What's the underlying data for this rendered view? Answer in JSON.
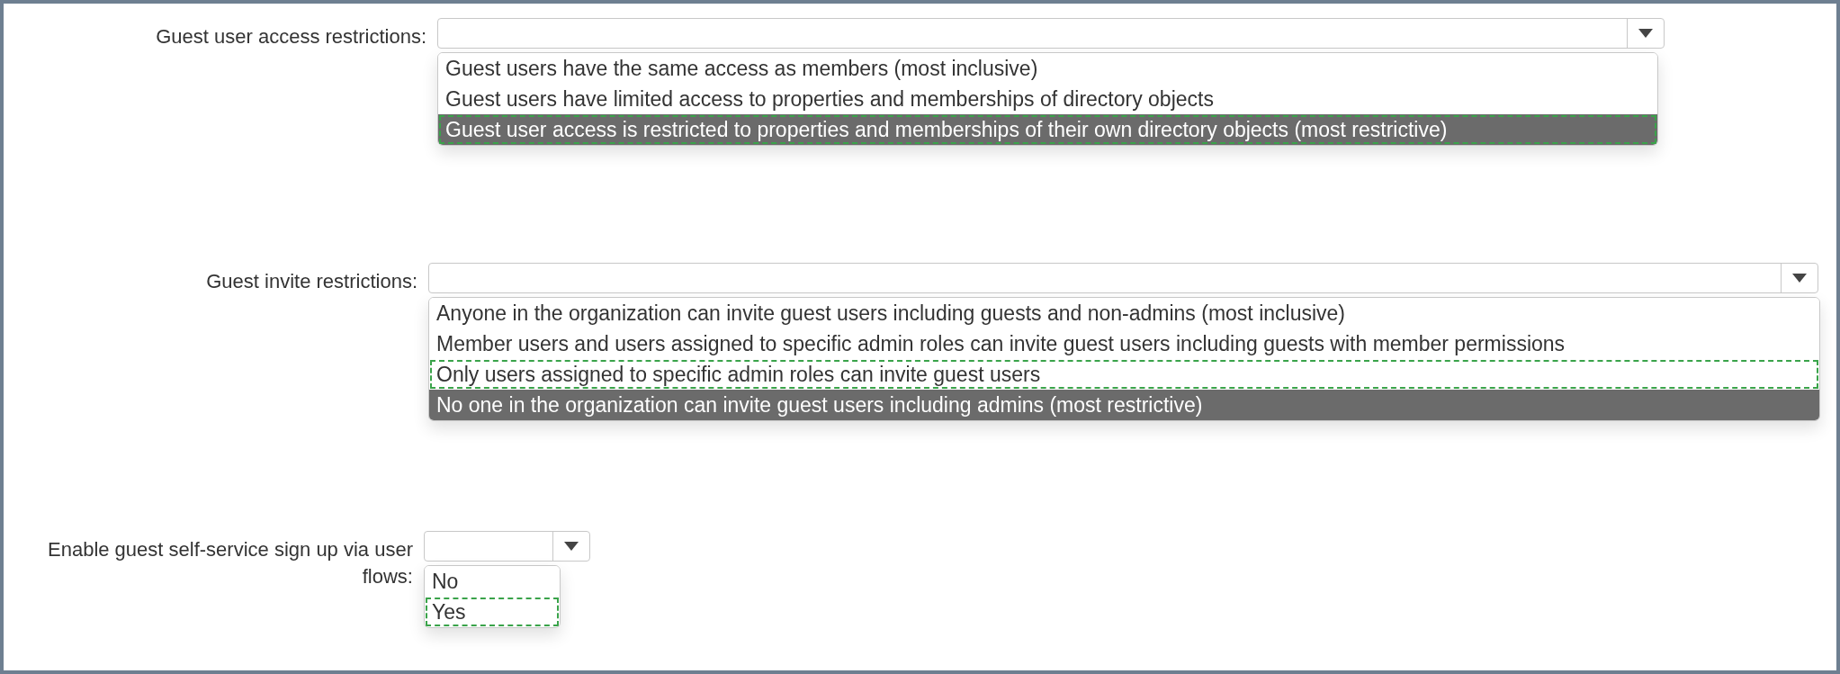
{
  "settings": [
    {
      "label": "Guest user access restrictions:",
      "kind": "wide",
      "options": [
        {
          "text": "Guest users have the same access as members (most inclusive)",
          "selected": false,
          "marked": false
        },
        {
          "text": "Guest users have limited access to properties and memberships of directory objects",
          "selected": false,
          "marked": false
        },
        {
          "text": "Guest user access is restricted to properties and memberships of their own directory objects (most restrictive)",
          "selected": true,
          "marked": true
        }
      ]
    },
    {
      "label": "Guest invite restrictions:",
      "kind": "full",
      "options": [
        {
          "text": "Anyone in the organization can invite guest users including guests and non-admins (most inclusive)",
          "selected": false,
          "marked": false
        },
        {
          "text": "Member users and users assigned to specific admin roles can invite guest users including guests with member permissions",
          "selected": false,
          "marked": false
        },
        {
          "text": "Only users assigned to specific admin roles can invite guest users",
          "selected": false,
          "marked": true
        },
        {
          "text": "No one in the organization can invite guest users including admins (most restrictive)",
          "selected": true,
          "marked": false
        }
      ]
    },
    {
      "label": "Enable guest self-service sign up via user flows:",
      "kind": "small",
      "options": [
        {
          "text": "No",
          "selected": false,
          "marked": false
        },
        {
          "text": "Yes",
          "selected": false,
          "marked": true
        }
      ]
    }
  ]
}
